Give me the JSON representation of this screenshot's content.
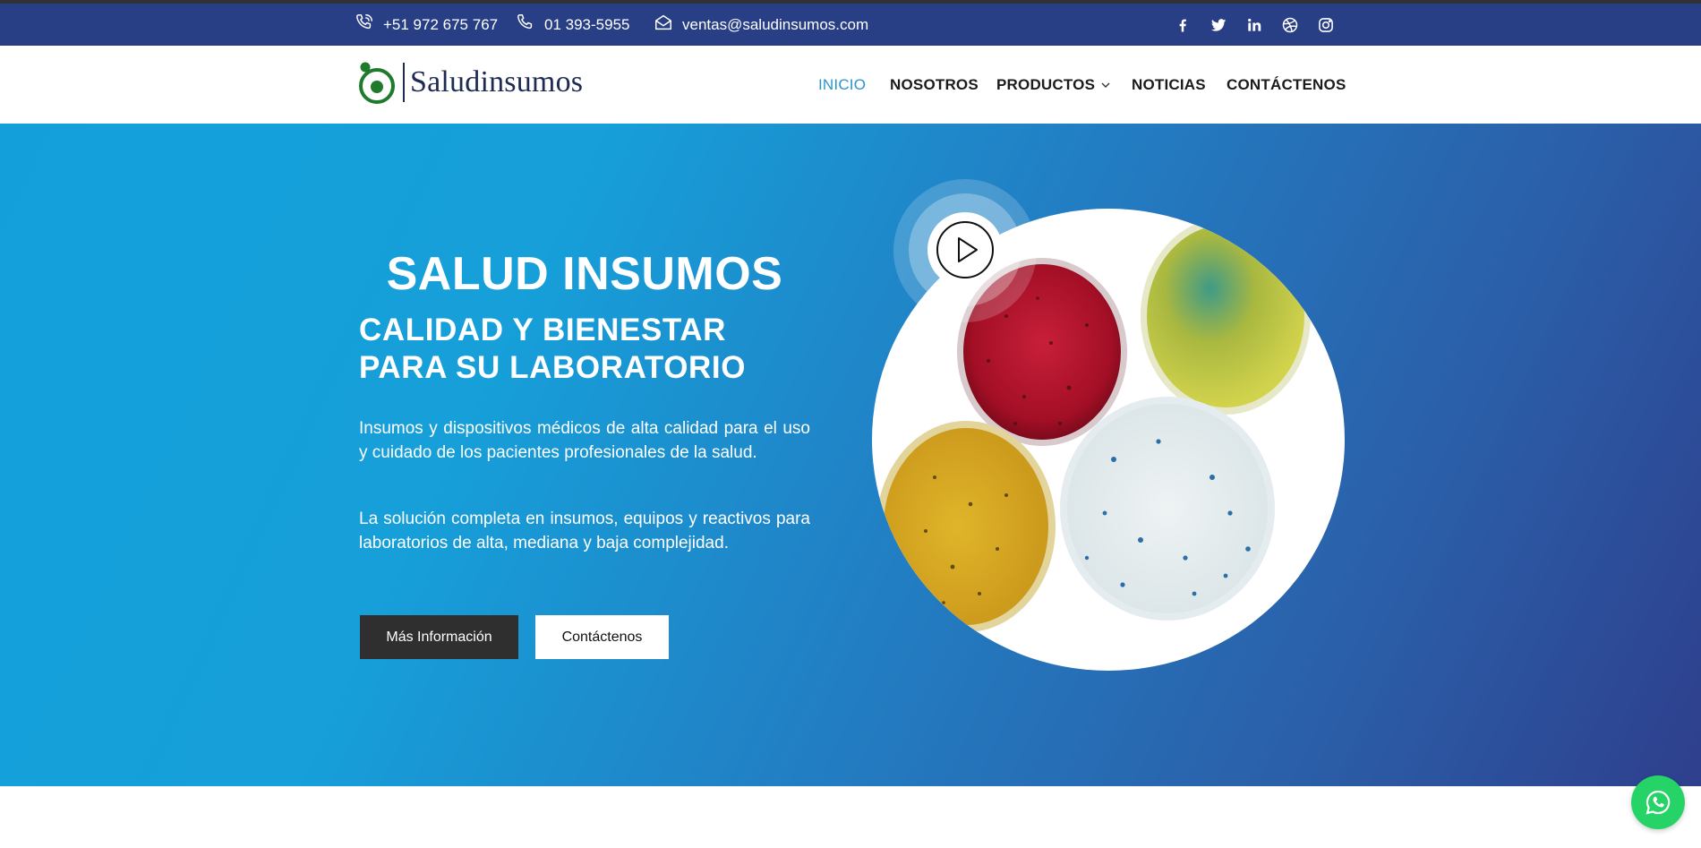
{
  "topbar": {
    "phone_mobile": "+51 972 675 767",
    "phone_landline": "01 393-5955",
    "email": "ventas@saludinsumos.com",
    "socials": [
      "facebook-icon",
      "twitter-icon",
      "linkedin-icon",
      "dribbble-icon",
      "instagram-icon"
    ]
  },
  "header": {
    "logo_text": "Saludinsumos",
    "nav": [
      {
        "label": "INICIO",
        "active": true
      },
      {
        "label": "NOSOTROS",
        "active": false
      },
      {
        "label": "PRODUCTOS",
        "active": false,
        "has_dropdown": true
      },
      {
        "label": "NOTICIAS",
        "active": false
      },
      {
        "label": "CONTÁCTENOS",
        "active": false
      }
    ]
  },
  "hero": {
    "title": "SALUD INSUMOS",
    "subtitle": "CALIDAD Y BIENESTAR PARA SU LABORATORIO",
    "paragraph1": "Insumos y dispositivos médicos de alta calidad para el uso y cuidado de los pacientes profesionales de la salud.",
    "paragraph2": "La solución completa en insumos, equipos y reactivos para laboratorios de alta, mediana y baja complejidad.",
    "button_primary": "Más Información",
    "button_secondary": "Contáctenos",
    "media": "petri-dishes-image",
    "video": "play-icon"
  },
  "floating": {
    "whatsapp": "whatsapp-icon"
  },
  "colors": {
    "topbar": "#283f86",
    "nav_active": "#2a95c9",
    "hero_start": "#13a0da",
    "hero_end": "#2e3f8d",
    "button_dark": "#2f2f2f",
    "whatsapp": "#25d366",
    "logo_green": "#1f7a2c",
    "logo_navy": "#1d2a52"
  }
}
